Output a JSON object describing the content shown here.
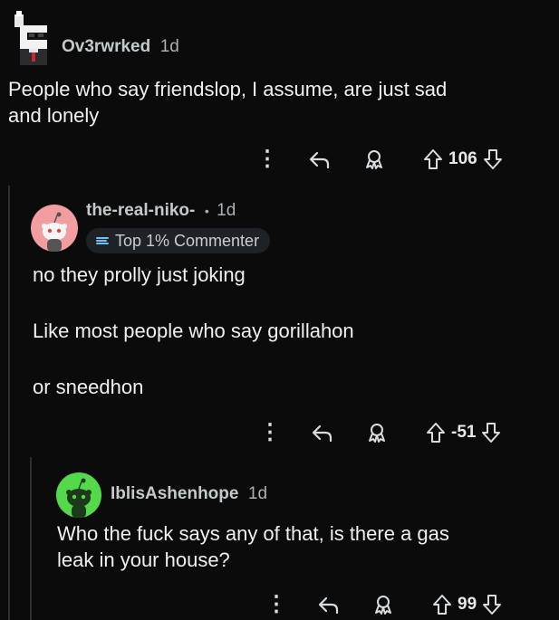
{
  "comments": [
    {
      "username": "Ov3rwrked",
      "time": "1d",
      "body": "People who say friendslop, I assume, are just sad\nand lonely",
      "score": "106"
    },
    {
      "username": "the-real-niko-",
      "separator": "•",
      "time": "1d",
      "badge": "Top 1% Commenter",
      "body": "no they prolly just joking\n\nLike most people who say gorillahon\n\nor sneedhon",
      "score": "-51"
    },
    {
      "username": "IblisAshenhope",
      "time": "1d",
      "body": "Who the fuck says any of that, is there a gas\nleak in your house?",
      "score": "99"
    }
  ],
  "colors": {
    "background": "#0b0b0c",
    "avatar_pink": "#f29ea0",
    "avatar_green": "#53d94a"
  },
  "icons": [
    "kebab-menu-icon",
    "reply-icon",
    "award-icon",
    "upvote-icon",
    "downvote-icon",
    "top-commenter-icon"
  ]
}
